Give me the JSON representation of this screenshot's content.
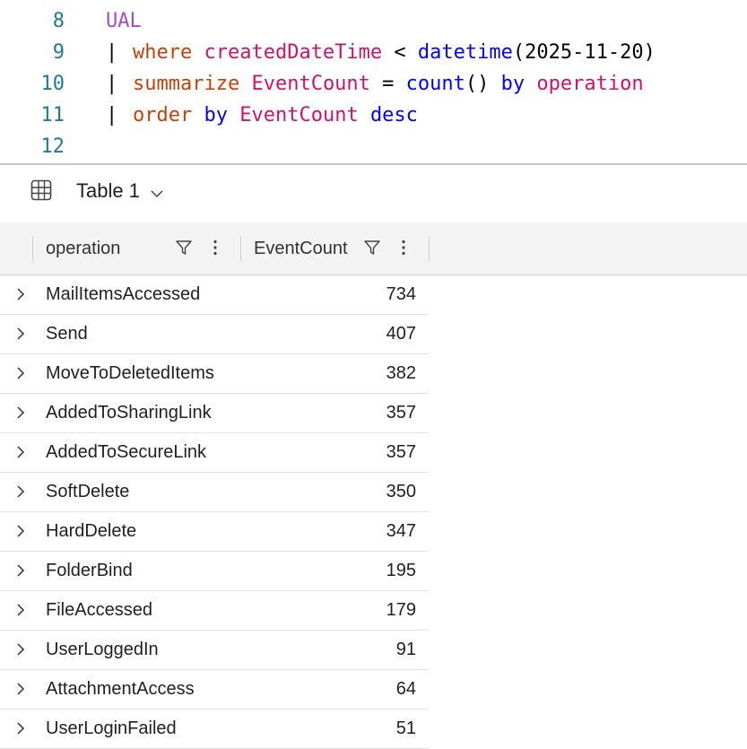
{
  "editor": {
    "lines": [
      {
        "num": "8",
        "tokens": {
          "table": "UAL"
        }
      },
      {
        "num": "9",
        "tokens": {
          "pipe": "|",
          "op": "where",
          "col": "createdDateTime",
          "mid": " < ",
          "fn": "datetime",
          "rest": "(2025-11-20)"
        }
      },
      {
        "num": "10",
        "tokens": {
          "pipe": "|",
          "op": "summarize",
          "col": "EventCount",
          "eq": " = ",
          "fn": "count",
          "paren": "()",
          "by": "by",
          "col2": "operation"
        }
      },
      {
        "num": "11",
        "tokens": {
          "pipe": "|",
          "op": "order",
          "by": "by",
          "col": "EventCount",
          "desc": "desc"
        }
      },
      {
        "num": "12"
      }
    ]
  },
  "results": {
    "table_icon": "table-grid-icon",
    "title": "Table 1",
    "columns": [
      {
        "label": "operation"
      },
      {
        "label": "EventCount"
      }
    ],
    "rows": [
      {
        "operation": "MailItemsAccessed",
        "count": "734"
      },
      {
        "operation": "Send",
        "count": "407"
      },
      {
        "operation": "MoveToDeletedItems",
        "count": "382"
      },
      {
        "operation": "AddedToSharingLink",
        "count": "357"
      },
      {
        "operation": "AddedToSecureLink",
        "count": "357"
      },
      {
        "operation": "SoftDelete",
        "count": "350"
      },
      {
        "operation": "HardDelete",
        "count": "347"
      },
      {
        "operation": "FolderBind",
        "count": "195"
      },
      {
        "operation": "FileAccessed",
        "count": "179"
      },
      {
        "operation": "UserLoggedIn",
        "count": "91"
      },
      {
        "operation": "AttachmentAccess",
        "count": "64"
      },
      {
        "operation": "UserLoginFailed",
        "count": "51"
      }
    ]
  },
  "colors": {
    "line_number": "#237893",
    "table_name": "#a84ac9",
    "operator_keyword": "#c2410c",
    "function": "#0000ff",
    "column": "#c8146e"
  }
}
